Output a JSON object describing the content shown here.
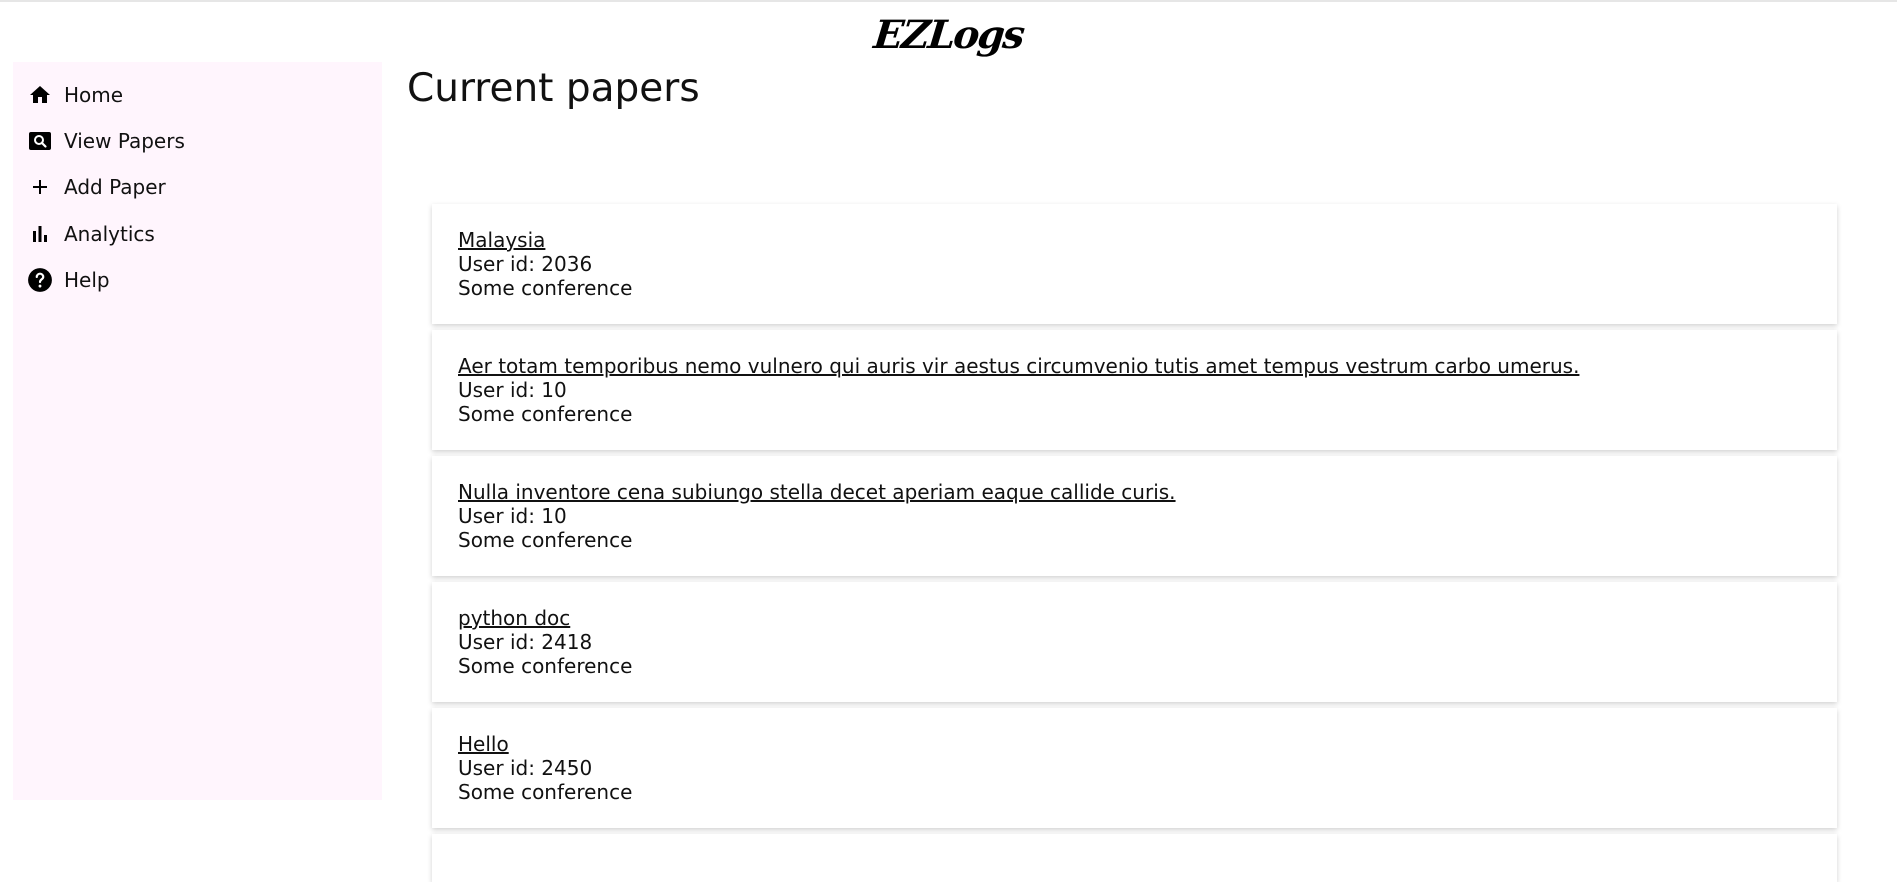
{
  "header": {
    "logo_text": "EZLogs"
  },
  "sidebar": {
    "items": [
      {
        "label": "Home",
        "icon": "home-icon"
      },
      {
        "label": "View Papers",
        "icon": "search-icon"
      },
      {
        "label": "Add Paper",
        "icon": "plus-icon"
      },
      {
        "label": "Analytics",
        "icon": "bar-chart-icon"
      },
      {
        "label": "Help",
        "icon": "help-icon"
      }
    ]
  },
  "main": {
    "title": "Current papers",
    "papers": [
      {
        "title": "Malaysia",
        "user": "User id: 2036",
        "conference": "Some conference"
      },
      {
        "title": "Aer totam temporibus nemo vulnero qui auris vir aestus circumvenio tutis amet tempus vestrum carbo umerus.",
        "user": "User id: 10",
        "conference": "Some conference"
      },
      {
        "title": "Nulla inventore cena subiungo stella decet aperiam eaque callide curis.",
        "user": "User id: 10",
        "conference": "Some conference"
      },
      {
        "title": "python doc",
        "user": "User id: 2418",
        "conference": "Some conference"
      },
      {
        "title": "Hello",
        "user": "User id: 2450",
        "conference": "Some conference"
      }
    ]
  },
  "colors": {
    "sidebar_bg": "#fff5fd",
    "text": "#111111"
  }
}
